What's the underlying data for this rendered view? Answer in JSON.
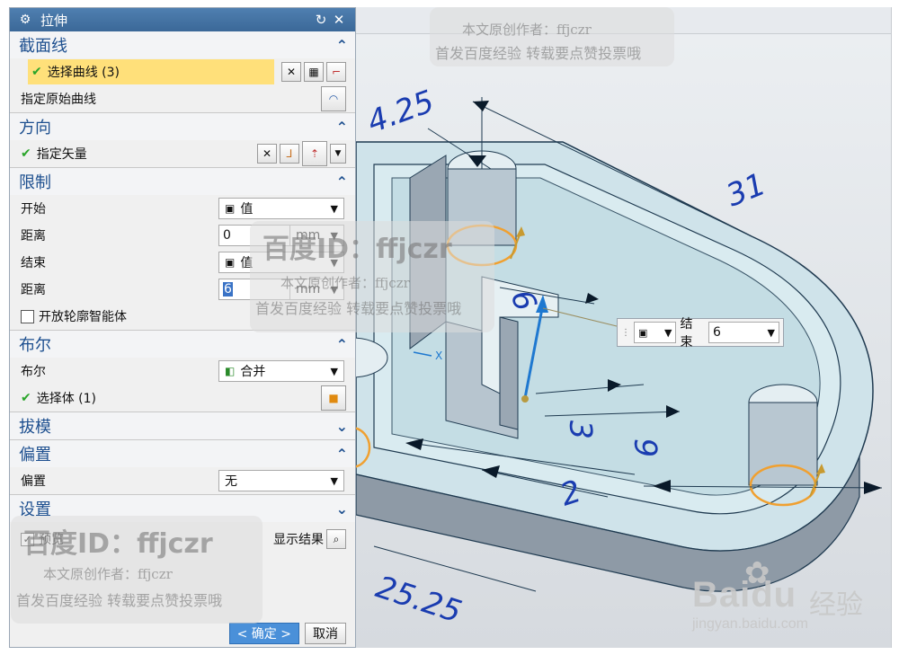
{
  "dialog": {
    "title": "拉伸",
    "title_icons": {
      "gear": "⚙",
      "reset": "↻",
      "close": "✕"
    },
    "sections": {
      "section_curve": {
        "title": "截面线",
        "select_curve": "选择曲线 (3)",
        "specify_original": "指定原始曲线"
      },
      "direction": {
        "title": "方向",
        "specify_vector": "指定矢量"
      },
      "limits": {
        "title": "限制",
        "start_label": "开始",
        "start_type": "值",
        "start_distance_label": "距离",
        "start_distance": "0",
        "end_label": "结束",
        "end_type": "值",
        "end_distance_label": "距离",
        "end_distance": "6",
        "unit": "mm",
        "open_profile": "开放轮廓智能体"
      },
      "boolean": {
        "title": "布尔",
        "label": "布尔",
        "value": "合并",
        "select_body": "选择体 (1)"
      },
      "draft": {
        "title": "拔模"
      },
      "offset": {
        "title": "偏置",
        "label": "偏置",
        "value": "无"
      },
      "settings": {
        "title": "设置"
      }
    },
    "preview_label": "预览",
    "show_result_label": "显示结果",
    "ok_label": "< 确定 >",
    "cancel_label": "取消"
  },
  "floating_input": {
    "label": "结束",
    "value": "6"
  },
  "dimensions": {
    "d1": "4.25",
    "d2": "31",
    "d3": "6",
    "d4": "3",
    "d5": "9",
    "d6": "2",
    "d7": "25.25",
    "axis_x": "X"
  },
  "watermarks": {
    "id_text": "百度ID：ffjczr",
    "author": "本文原创作者：ffjczr",
    "notice": "首发百度经验  转载要点赞投票哦",
    "brand": "Baidu",
    "brand_cn": "经验",
    "url": "jingyan.baidu.com"
  },
  "colors": {
    "title_bar": "#3b6898",
    "section_title": "#1d4f8f",
    "highlight": "#ffe07a",
    "check": "#2aa52a",
    "model_fill": "#c9dfe6",
    "edge_orange": "#f0a030"
  }
}
